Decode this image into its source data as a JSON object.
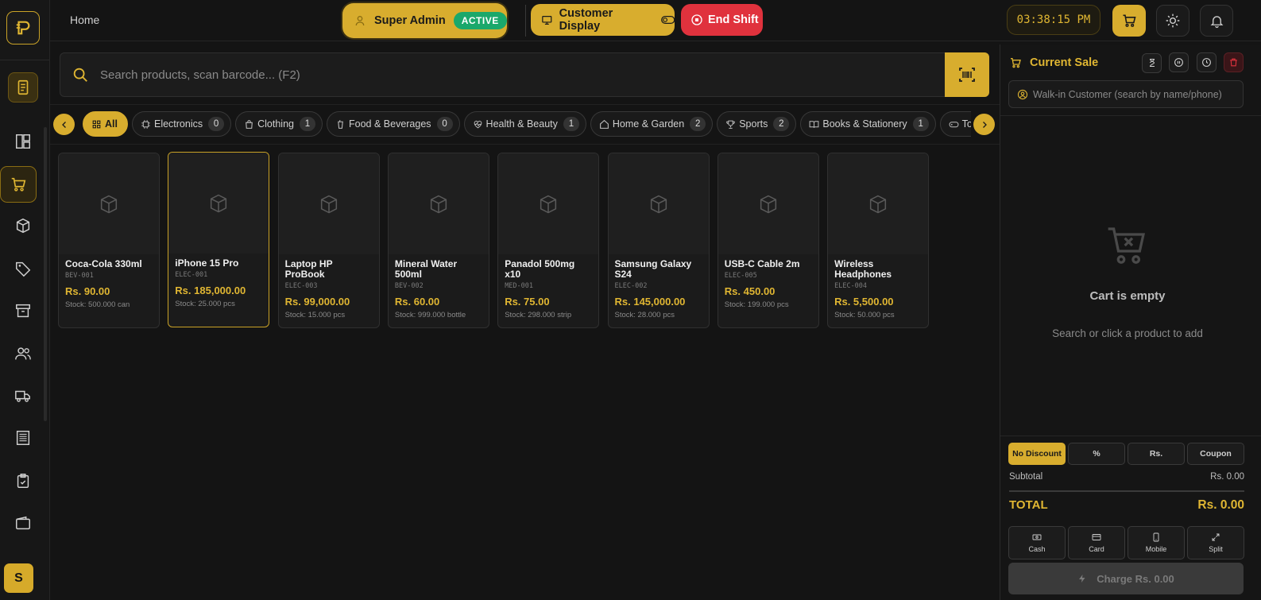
{
  "header": {
    "breadcrumb": "Home",
    "user_label": "Super Admin",
    "user_status": "ACTIVE",
    "customer_display_label": "Customer Display",
    "end_shift_label": "End Shift",
    "clock": "03:38:15 PM"
  },
  "sidebar": {
    "avatar_initial": "S",
    "items": [
      "dashboard-doc",
      "layout",
      "pos-cart",
      "products",
      "tags",
      "archive",
      "users",
      "delivery",
      "reports",
      "orders",
      "wallet"
    ]
  },
  "search": {
    "placeholder": "Search products, scan barcode... (F2)"
  },
  "categories": [
    {
      "label": "All",
      "count": null,
      "icon": "grid-icon"
    },
    {
      "label": "Electronics",
      "count": "0",
      "icon": "chip-icon"
    },
    {
      "label": "Clothing",
      "count": "1",
      "icon": "bag-icon"
    },
    {
      "label": "Food & Beverages",
      "count": "0",
      "icon": "cup-icon"
    },
    {
      "label": "Health & Beauty",
      "count": "1",
      "icon": "heart-pulse-icon"
    },
    {
      "label": "Home & Garden",
      "count": "2",
      "icon": "home-icon"
    },
    {
      "label": "Sports",
      "count": "2",
      "icon": "trophy-icon"
    },
    {
      "label": "Books & Stationery",
      "count": "1",
      "icon": "book-icon"
    },
    {
      "label": "Toys & Games",
      "count": "",
      "icon": "gamepad-icon"
    }
  ],
  "products": [
    {
      "name": "Coca-Cola 330ml",
      "sku": "BEV-001",
      "price": "Rs. 90.00",
      "stock": "Stock: 500.000 can"
    },
    {
      "name": "iPhone 15 Pro",
      "sku": "ELEC-001",
      "price": "Rs. 185,000.00",
      "stock": "Stock: 25.000 pcs"
    },
    {
      "name": "Laptop HP ProBook",
      "sku": "ELEC-003",
      "price": "Rs. 99,000.00",
      "stock": "Stock: 15.000 pcs"
    },
    {
      "name": "Mineral Water 500ml",
      "sku": "BEV-002",
      "price": "Rs. 60.00",
      "stock": "Stock: 999.000 bottle"
    },
    {
      "name": "Panadol 500mg x10",
      "sku": "MED-001",
      "price": "Rs. 75.00",
      "stock": "Stock: 298.000 strip"
    },
    {
      "name": "Samsung Galaxy S24",
      "sku": "ELEC-002",
      "price": "Rs. 145,000.00",
      "stock": "Stock: 28.000 pcs"
    },
    {
      "name": "USB-C Cable 2m",
      "sku": "ELEC-005",
      "price": "Rs. 450.00",
      "stock": "Stock: 199.000 pcs"
    },
    {
      "name": "Wireless Headphones",
      "sku": "ELEC-004",
      "price": "Rs. 5,500.00",
      "stock": "Stock: 50.000 pcs"
    }
  ],
  "cart": {
    "title": "Current Sale",
    "customer_placeholder": "Walk-in Customer (search by name/phone)",
    "empty_title": "Cart is empty",
    "empty_subtitle": "Search or click a product to add",
    "discounts": [
      "No Discount",
      "%",
      "Rs.",
      "Coupon"
    ],
    "subtotal_label": "Subtotal",
    "subtotal_value": "Rs. 0.00",
    "total_label": "TOTAL",
    "total_value": "Rs. 0.00",
    "payments": [
      "Cash",
      "Card",
      "Mobile",
      "Split"
    ],
    "charge_label": "Charge Rs. 0.00"
  },
  "colors": {
    "accent": "#d8ad2e",
    "danger": "#e0323d",
    "success": "#1aa86b",
    "background": "#141414"
  }
}
